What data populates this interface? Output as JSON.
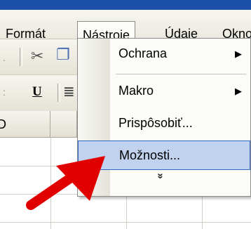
{
  "menubar": {
    "items": [
      {
        "label": "Formát"
      },
      {
        "label": "Nástroje",
        "open": true
      },
      {
        "label": "Údaje"
      },
      {
        "label": "Okno"
      }
    ]
  },
  "toolbar": {
    "icons": [
      "cut-icon",
      "copy-icon",
      "underline-icon",
      "align-icon"
    ],
    "underline_label": "U"
  },
  "sheet": {
    "column_header": "D"
  },
  "dropdown": {
    "items": [
      {
        "label": "Ochrana",
        "submenu": true
      },
      {
        "label": "Makro",
        "submenu": true
      },
      {
        "label": "Prispôsobiť...",
        "submenu": false
      },
      {
        "label": "Možnosti...",
        "submenu": false,
        "highlighted": true
      }
    ],
    "expand_glyph": "»"
  },
  "colors": {
    "menu_bg": "#ebe9df",
    "highlight_bg": "#c1d2ee",
    "highlight_border": "#316ac5",
    "annotation_red": "#e00000"
  }
}
